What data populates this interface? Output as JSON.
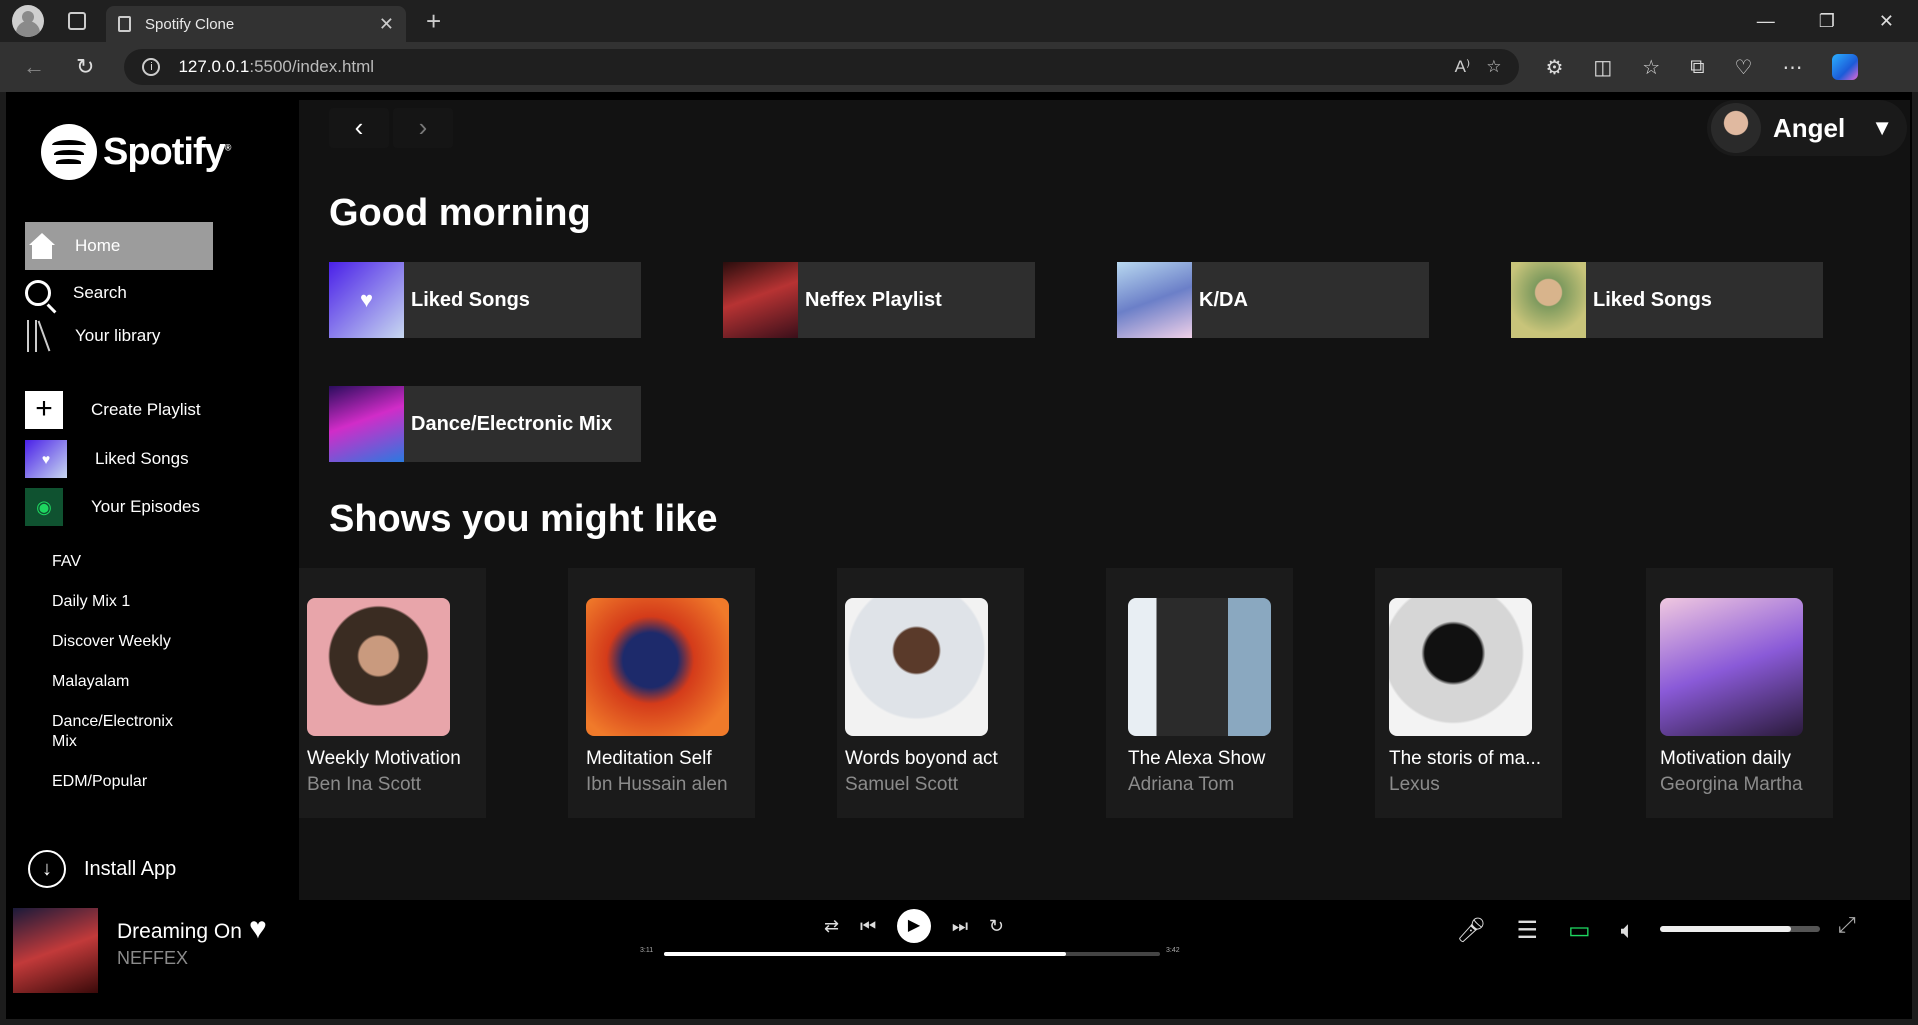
{
  "browser": {
    "tab_title": "Spotify Clone",
    "tab_close": "✕",
    "new_tab": "+",
    "url_host": "127.0.0.1",
    "url_rest": ":5500/index.html",
    "win_min": "—",
    "win_restore": "❐",
    "win_close": "✕"
  },
  "sidebar": {
    "logo_text": "Spotify",
    "home": "Home",
    "search": "Search",
    "library": "Your library",
    "create_playlist": "Create Playlist",
    "liked_songs": "Liked Songs",
    "episodes": "Your Episodes",
    "playlists": [
      "FAV",
      "Daily Mix 1",
      "Discover Weekly",
      "Malayalam",
      "Dance/Electronix Mix",
      "EDM/Popular"
    ],
    "install": "Install App"
  },
  "header": {
    "user_name": "Angel"
  },
  "main": {
    "greeting": "Good morning",
    "quick": [
      {
        "label": "Liked Songs"
      },
      {
        "label": "Neffex Playlist"
      },
      {
        "label": "K/DA"
      },
      {
        "label": "Liked Songs"
      },
      {
        "label": "Dance/Electronic Mix"
      }
    ],
    "shows_heading": "Shows you might like",
    "shows": [
      {
        "title": "Weekly Motivation",
        "author": "Ben Ina Scott"
      },
      {
        "title": "Meditation Self",
        "author": "Ibn Hussain alen"
      },
      {
        "title": "Words boyond act",
        "author": "Samuel Scott"
      },
      {
        "title": "The Alexa Show",
        "author": "Adriana Tom"
      },
      {
        "title": "The storis of ma...",
        "author": "Lexus"
      },
      {
        "title": "Motivation daily",
        "author": "Georgina Martha"
      }
    ]
  },
  "player": {
    "title": "Dreaming On",
    "artist": "NEFFEX",
    "current_time": "3:11",
    "total_time": "3:42",
    "progress_fraction": 0.81,
    "volume_fraction": 0.82
  }
}
